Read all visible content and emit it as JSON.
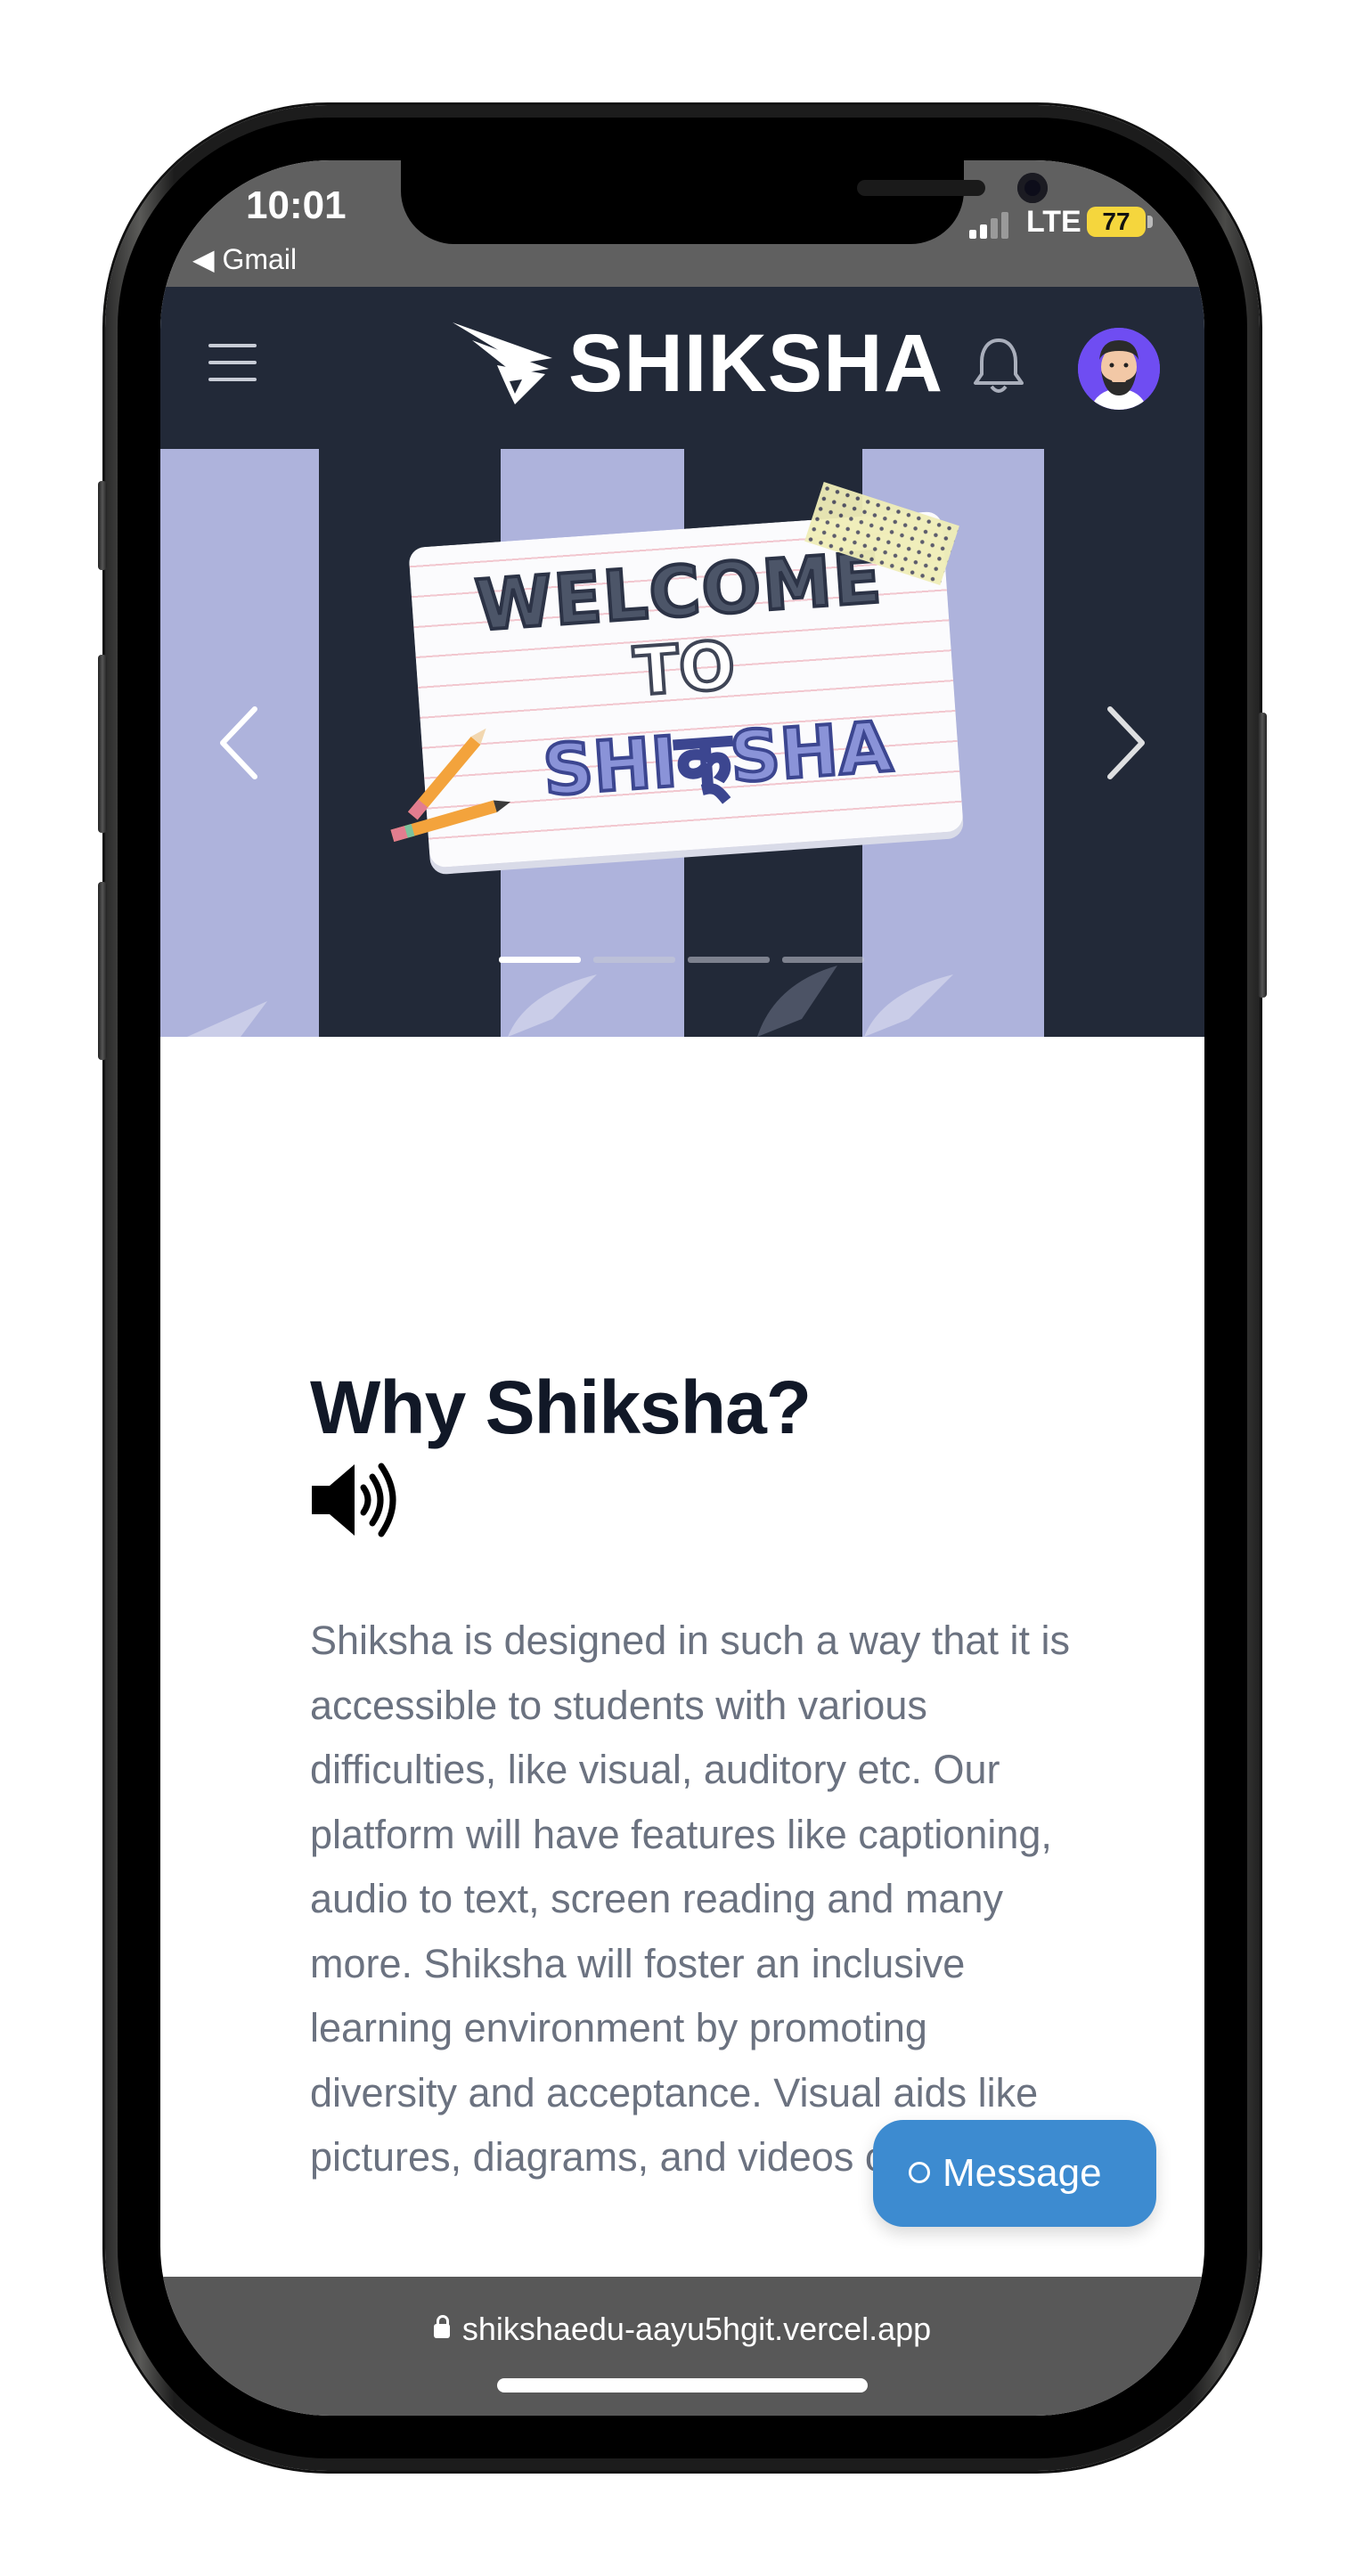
{
  "status_bar": {
    "time": "10:01",
    "back_app": "◀ Gmail",
    "network": "LTE",
    "battery": "77"
  },
  "header": {
    "logo_text": "SHIKSHA",
    "icons": [
      "menu-icon",
      "logo-wing-icon",
      "bell-icon",
      "avatar"
    ]
  },
  "carousel": {
    "slide_lines": [
      "WELCOME",
      "TO",
      "SHIक्SHA"
    ],
    "slide_count": 4,
    "active_slide": 1,
    "stripe_color": "#aeb3dc",
    "background_color": "#222938"
  },
  "content": {
    "title": "Why Shiksha?",
    "description": "Shiksha is designed in such a way that it is accessible to students with various difficulties, like visual, auditory etc. Our platform will have features like captioning, audio to text, screen reading and many more. Shiksha will foster an inclusive learning environment by promoting diversity and acceptance. Visual aids like pictures, diagrams, and videos can"
  },
  "message_button": {
    "label": "Message",
    "color": "#3d8bd0"
  },
  "browser": {
    "url": "shikshaedu-aayu5hgit.vercel.app"
  }
}
